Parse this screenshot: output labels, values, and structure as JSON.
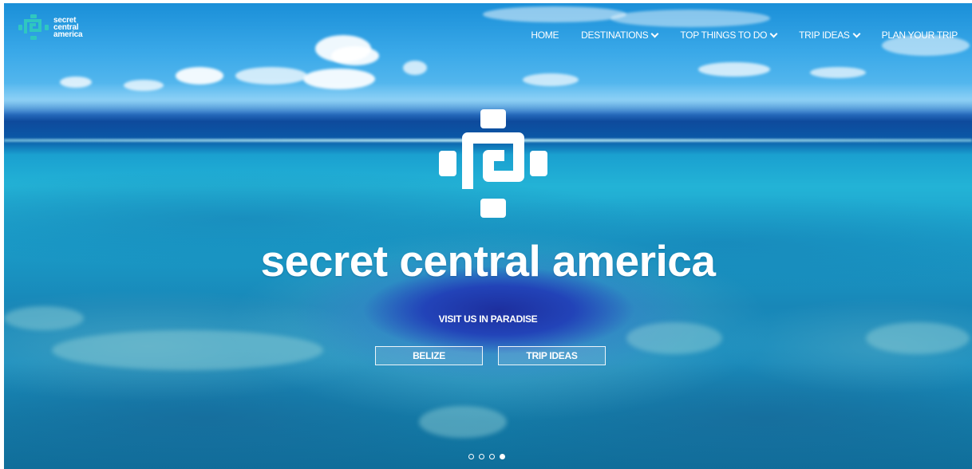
{
  "brand": {
    "line1": "secret",
    "line2": "central",
    "line3": "america",
    "logo_color": "#2fc7c0"
  },
  "nav": {
    "items": [
      {
        "label": "HOME",
        "dropdown": false
      },
      {
        "label": "DESTINATIONS",
        "dropdown": true
      },
      {
        "label": "TOP THINGS TO DO",
        "dropdown": true
      },
      {
        "label": "TRIP IDEAS",
        "dropdown": true
      },
      {
        "label": "PLAN YOUR TRIP",
        "dropdown": false
      }
    ]
  },
  "hero": {
    "logo_icon": "secret-central-america-symbol",
    "title": "secret central america",
    "subtitle": "VISIT US IN PARADISE",
    "buttons": [
      {
        "label": "BELIZE"
      },
      {
        "label": "TRIP IDEAS"
      }
    ]
  },
  "slider": {
    "total": 4,
    "active_index": 3
  },
  "colors": {
    "text": "#ffffff",
    "sky": "#39a8e8",
    "sea": "#1aa0d0"
  }
}
